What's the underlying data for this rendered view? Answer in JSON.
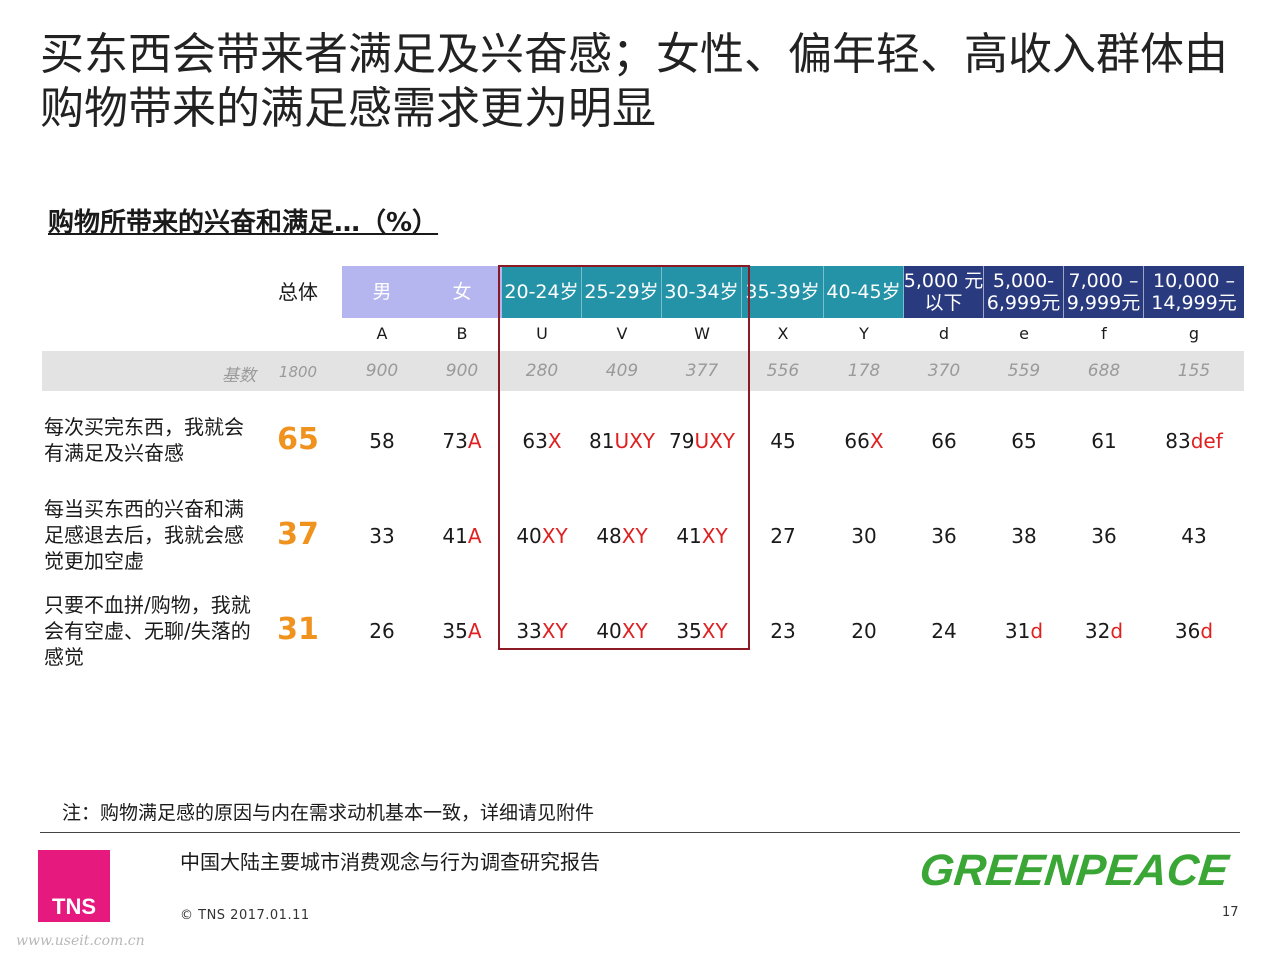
{
  "title": "买东西会带来者满足及兴奋感；女性、偏年轻、高收入群体由购物带来的满足感需求更为明显",
  "subtitle": "购物所带来的兴奋和满足…（%）",
  "columns": [
    {
      "header": "总体",
      "letter": "",
      "base": "1800"
    },
    {
      "header": "男",
      "letter": "A",
      "base": "900"
    },
    {
      "header": "女",
      "letter": "B",
      "base": "900"
    },
    {
      "header": "20-24岁",
      "letter": "U",
      "base": "280"
    },
    {
      "header": "25-29岁",
      "letter": "V",
      "base": "409"
    },
    {
      "header": "30-34岁",
      "letter": "W",
      "base": "377"
    },
    {
      "header": "35-39岁",
      "letter": "X",
      "base": "556"
    },
    {
      "header": "40-45岁",
      "letter": "Y",
      "base": "178"
    },
    {
      "header_line1": "5,000 元",
      "header_line2": "以下",
      "letter": "d",
      "base": "370"
    },
    {
      "header_line1": "5,000-",
      "header_line2": "6,999元",
      "letter": "e",
      "base": "559"
    },
    {
      "header_line1": "7,000 –",
      "header_line2": "9,999元",
      "letter": "f",
      "base": "688"
    },
    {
      "header_line1": "10,000 –",
      "header_line2": "14,999元",
      "letter": "g",
      "base": "155"
    }
  ],
  "base_label": "基数",
  "rows": [
    {
      "label": "每次买完东西，我就会有满足及兴奋感",
      "total": "65",
      "cells": [
        {
          "v": "58",
          "s": ""
        },
        {
          "v": "73",
          "s": "A"
        },
        {
          "v": "63",
          "s": "X"
        },
        {
          "v": "81",
          "s": "UXY"
        },
        {
          "v": "79",
          "s": "UXY"
        },
        {
          "v": "45",
          "s": ""
        },
        {
          "v": "66",
          "s": "X"
        },
        {
          "v": "66",
          "s": ""
        },
        {
          "v": "65",
          "s": ""
        },
        {
          "v": "61",
          "s": ""
        },
        {
          "v": "83",
          "s": "def"
        }
      ]
    },
    {
      "label": "每当买东西的兴奋和满足感退去后，我就会感觉更加空虚",
      "total": "37",
      "cells": [
        {
          "v": "33",
          "s": ""
        },
        {
          "v": "41",
          "s": "A"
        },
        {
          "v": "40",
          "s": "XY"
        },
        {
          "v": "48",
          "s": "XY"
        },
        {
          "v": "41",
          "s": "XY"
        },
        {
          "v": "27",
          "s": ""
        },
        {
          "v": "30",
          "s": ""
        },
        {
          "v": "36",
          "s": ""
        },
        {
          "v": "38",
          "s": ""
        },
        {
          "v": "36",
          "s": ""
        },
        {
          "v": "43",
          "s": ""
        }
      ]
    },
    {
      "label": "只要不血拼/购物，我就会有空虚、无聊/失落的感觉",
      "total": "31",
      "cells": [
        {
          "v": "26",
          "s": ""
        },
        {
          "v": "35",
          "s": "A"
        },
        {
          "v": "33",
          "s": "XY"
        },
        {
          "v": "40",
          "s": "XY"
        },
        {
          "v": "35",
          "s": "XY"
        },
        {
          "v": "23",
          "s": ""
        },
        {
          "v": "20",
          "s": ""
        },
        {
          "v": "24",
          "s": ""
        },
        {
          "v": "31",
          "s": "d"
        },
        {
          "v": "32",
          "s": "d"
        },
        {
          "v": "36",
          "s": "d"
        }
      ]
    }
  ],
  "note": "注：购物满足感的原因与内在需求动机基本一致，详细请见附件",
  "footer": {
    "logo": "TNS",
    "report": "中国大陆主要城市消费观念与行为调查研究报告",
    "copyright": "© TNS 2017.01.11",
    "brand": "GREENPEACE",
    "page": "17",
    "watermark": "www.useit.com.cn"
  },
  "colors": {
    "gender_header": "#b5b5ef",
    "age_header": "#2493a8",
    "income_header": "#2a3a7e",
    "total_highlight": "#f0921e",
    "significance": "#e02020",
    "box_outline": "#8b1a24",
    "logo_bg": "#e6197f",
    "brand_green": "#3aa635"
  }
}
